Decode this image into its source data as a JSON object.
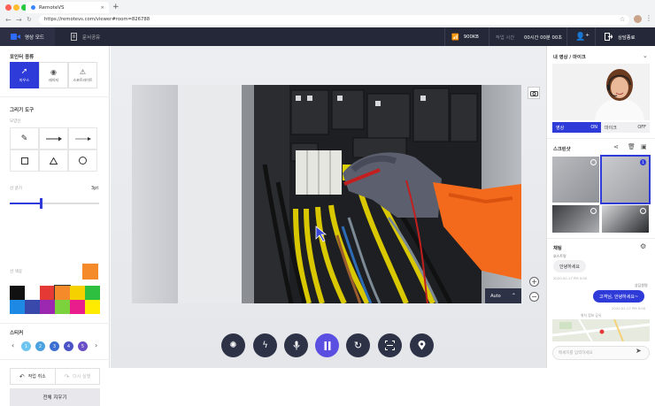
{
  "browser": {
    "tab_title": "RemoteVS",
    "url": "https://remotevs.com/viewer#room=826788"
  },
  "header": {
    "mode_video": "영상 모드",
    "mode_document": "문서공유",
    "bandwidth": "900KB",
    "time_label": "작업 시간",
    "time_value": "00시간 00분 00초",
    "end_label": "상담종료"
  },
  "left": {
    "pointer_title": "포인터 종류",
    "pointer_tools": [
      {
        "label": "마우스",
        "icon": "cursor-icon",
        "active": true
      },
      {
        "label": "레이저",
        "icon": "laser-icon",
        "active": false
      },
      {
        "label": "스포트라이트",
        "icon": "spotlight-icon",
        "active": false
      }
    ],
    "draw_title": "그리기 도구",
    "shape_label": "모양선",
    "thickness_label": "선 굵기",
    "thickness_value": "3pt",
    "thickness_fraction": 0.35,
    "color_label": "선 색상",
    "selected_color": "#f58a2b",
    "palette": [
      "#111111",
      "#ffffff",
      "#e53935",
      "#f58a2b",
      "#f5d100",
      "#2fbf40",
      "#1e88e5",
      "#3949ab",
      "#9c27b0",
      "#7cd23c",
      "#e91e8c",
      "#ffeb00"
    ],
    "sticker_title": "스티커",
    "stickers": [
      "1",
      "2",
      "3",
      "4",
      "5"
    ],
    "undo_label": "작업 취소",
    "redo_label": "다시 실행",
    "clear_label": "전체 지우기"
  },
  "stage": {
    "auto_label": "Auto"
  },
  "right": {
    "camera_title": "내 영상 / 마이크",
    "video_label": "영상",
    "video_state": "ON",
    "mic_label": "마이크",
    "mic_state": "OFF",
    "screenshot_title": "스크린샷",
    "selected_count": "1",
    "chat_title": "채팅",
    "host_label": "호스트명",
    "msg1": "안녕하세요",
    "msg1_time": "2020.02.17 PM 5:00",
    "agent_label": "상담원명",
    "msg2": "고객님, 안녕하세요~",
    "msg2_time": "2020.02.17 PM 5:00",
    "location_label": "위치 정보 공유",
    "chat_placeholder": "메세지를 입력하세요"
  },
  "colors": {
    "accent": "#2f3bd9",
    "header_bg": "#242838"
  }
}
